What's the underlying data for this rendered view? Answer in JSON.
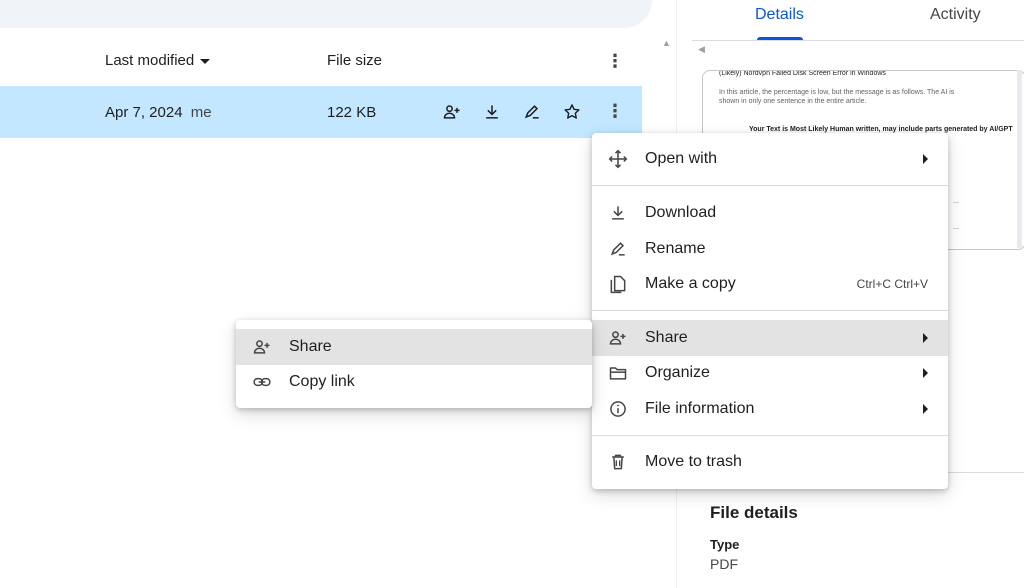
{
  "list": {
    "columns": {
      "last_modified": "Last modified",
      "file_size": "File size"
    },
    "selected_row": {
      "modified_date": "Apr 7, 2024",
      "modified_by": "me",
      "size": "122 KB"
    }
  },
  "details_panel": {
    "tabs": [
      "Details",
      "Activity"
    ],
    "active_tab": "Details",
    "preview": {
      "line_top": "(Likely) Nordvpn Failed Disk Screen Error in Windows",
      "line_1": "In this article, the percentage is low, but the message is as follows. The AI is",
      "line_2": "shown in only one sentence in the entire article.",
      "verdict": "Your Text is Most Likely Human written, may include parts generated by AI/GPT",
      "snip_1": "...",
      "snip_2": "..."
    },
    "file_details_title": "File details",
    "type_label": "Type",
    "type_value": "PDF"
  },
  "context_menu": {
    "open_with": "Open with",
    "download": "Download",
    "rename": "Rename",
    "make_copy": "Make a copy",
    "make_copy_shortcut": "Ctrl+C Ctrl+V",
    "share": "Share",
    "organize": "Organize",
    "file_information": "File information",
    "move_to_trash": "Move to trash"
  },
  "share_submenu": {
    "share": "Share",
    "copy_link": "Copy link"
  },
  "colors": {
    "selected_row": "#c2e7ff",
    "accent": "#0b57d0",
    "menu_highlight": "#e3e3e3"
  }
}
